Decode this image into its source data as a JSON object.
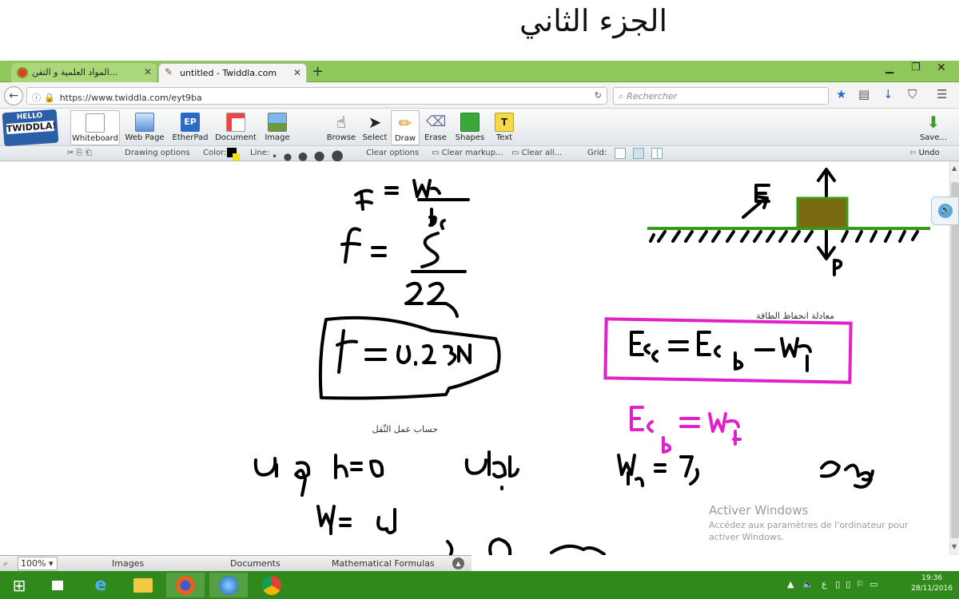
{
  "caption": {
    "arabic_heading": "الجزء الثاني"
  },
  "browser": {
    "tabs": [
      {
        "label": "المواد العلمية و التقن...",
        "active": false
      },
      {
        "label": "untitled - Twiddla.com",
        "active": true
      }
    ],
    "new_tab": "+",
    "url": "https://www.twiddla.com/eyt9ba",
    "search_placeholder": "Rechercher",
    "window_controls": [
      "minimize",
      "restore",
      "close"
    ]
  },
  "app": {
    "logo_top": "HELLO",
    "logo_bottom": "TWIDDLA!",
    "toolbar": [
      {
        "label": "Whiteboard",
        "icon": "whiteboard-icon",
        "active": true
      },
      {
        "label": "Web Page",
        "icon": "webpage-icon"
      },
      {
        "label": "EtherPad",
        "icon": "etherpad-icon",
        "glyph": "EP"
      },
      {
        "label": "Document",
        "icon": "document-icon"
      },
      {
        "label": "Image",
        "icon": "image-icon"
      },
      {
        "label": "Browse",
        "icon": "hand-icon"
      },
      {
        "label": "Select",
        "icon": "cursor-icon"
      },
      {
        "label": "Draw",
        "icon": "pencil-icon",
        "active": true
      },
      {
        "label": "Erase",
        "icon": "eraser-icon"
      },
      {
        "label": "Shapes",
        "icon": "shapes-icon"
      },
      {
        "label": "Text",
        "icon": "text-icon",
        "glyph": "T"
      }
    ],
    "save_label": "Save...",
    "options": {
      "drawing_options": "Drawing options",
      "color_label": "Color:",
      "line_label": "Line:",
      "clear_options": "Clear options",
      "clear_markup": "Clear markup...",
      "clear_all": "Clear all...",
      "grid_label": "Grid:",
      "undo": "Undo"
    },
    "bottom": {
      "zoom": "100%",
      "tabs": [
        "Images",
        "Documents",
        "Mathematical Formulas"
      ]
    }
  },
  "whiteboard": {
    "labels": {
      "energy_conservation": "معادلة انحفاظ الطاقة",
      "gravity_work": "حساب عمل الثّقل"
    },
    "colors": {
      "ink": "#000000",
      "magenta": "#e020c8",
      "ground": "#3a9b1a",
      "block": "#7a6a10"
    }
  },
  "watermark": {
    "title": "Activer Windows",
    "line1": "Accédez aux paramètres de l'ordinateur pour",
    "line2": "activer Windows."
  },
  "taskbar": {
    "apps": [
      "windows-start-icon",
      "store-icon",
      "ie-icon",
      "explorer-icon",
      "firefox-icon",
      "globe-icon",
      "chrome-icon"
    ],
    "time": "19:36",
    "date": "28/11/2016",
    "lang": "ع"
  }
}
